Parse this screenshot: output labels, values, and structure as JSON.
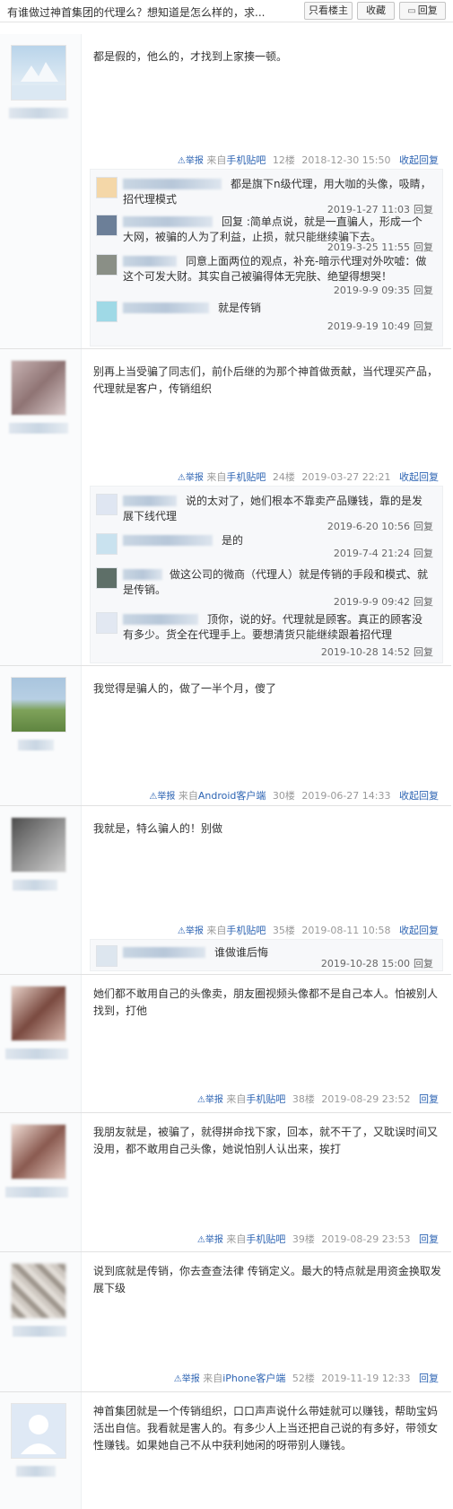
{
  "header": {
    "title": "有谁做过神首集团的代理么？想知道是怎么样的，求...",
    "only_op": "只看楼主",
    "favorite": "收藏",
    "reply": "回复"
  },
  "labels": {
    "report": "举报",
    "collapse_reply": "收起回复",
    "reply": "回复",
    "from": "来自"
  },
  "posts": [
    {
      "content": "都是假的，他么的，才找到上家揍一顿。",
      "source": "手机贴吧",
      "floor": "12楼",
      "time": "2018-12-30 15:50",
      "action": "收起回复",
      "replies": [
        {
          "text": "都是旗下n级代理，用大咖的头像，吸睛，招代理模式",
          "time": "2019-1-27 11:03"
        },
        {
          "text": "回复 :简单点说，就是一直骗人，形成一个大网，被骗的人为了利益，止损，就只能继续骗下去。",
          "time": "2019-3-25 11:55"
        },
        {
          "text": "同意上面两位的观点，补充-暗示代理对外吹嘘：做这个可发大财。其实自己被骗得体无完肤、绝望得想哭！",
          "time": "2019-9-9 09:35"
        },
        {
          "text": "就是传销",
          "time": "2019-9-19 10:49"
        }
      ]
    },
    {
      "content": "别再上当受骗了同志们，前仆后继的为那个神首做贡献，当代理买产品，代理就是客户，传销组织",
      "source": "手机贴吧",
      "floor": "24楼",
      "time": "2019-03-27 22:21",
      "action": "收起回复",
      "replies": [
        {
          "text": "说的太对了，她们根本不靠卖产品赚钱，靠的是发展下线代理",
          "time": "2019-6-20 10:56"
        },
        {
          "text": "是的",
          "time": "2019-7-4 21:24"
        },
        {
          "text": "做这公司的微商（代理人）就是传销的手段和模式、就是传销。",
          "time": "2019-9-9 09:42"
        },
        {
          "text": "顶你，说的好。代理就是顾客。真正的顾客没有多少。货全在代理手上。要想清货只能继续跟着招代理",
          "time": "2019-10-28 14:52"
        }
      ]
    },
    {
      "content": "我觉得是骗人的，做了一半个月，傻了",
      "source": "Android客户端",
      "floor": "30楼",
      "time": "2019-06-27 14:33",
      "action": "收起回复",
      "replies": []
    },
    {
      "content": "我就是，特么骗人的！别做",
      "source": "手机贴吧",
      "floor": "35楼",
      "time": "2019-08-11 10:58",
      "action": "收起回复",
      "replies": [
        {
          "text": "谁做谁后悔",
          "time": "2019-10-28 15:00"
        }
      ]
    },
    {
      "content": "她们都不敢用自己的头像卖，朋友圈视频头像都不是自己本人。怕被别人找到，打他",
      "source": "手机贴吧",
      "floor": "38楼",
      "time": "2019-08-29 23:52",
      "action": "回复",
      "replies": []
    },
    {
      "content": "我朋友就是，被骗了，就得拼命找下家，回本，就不干了，又耽误时间又没用，都不敢用自己头像，她说怕别人认出来，挨打",
      "source": "手机贴吧",
      "floor": "39楼",
      "time": "2019-08-29 23:53",
      "action": "回复",
      "replies": []
    },
    {
      "content": "说到底就是传销，你去查查法律 传销定义。最大的特点就是用资金换取发展下级",
      "source": "iPhone客户端",
      "floor": "52楼",
      "time": "2019-11-19 12:33",
      "action": "回复",
      "replies": []
    },
    {
      "content": "神首集团就是一个传销组织，口口声声说什么带娃就可以赚钱，帮助宝妈活出自信。我看就是害人的。有多少人上当还把自己说的有多好，带领女性赚钱。如果她自己不从中获利她闲的呀带别人赚钱。",
      "source": "",
      "floor": "",
      "time": "",
      "action": "",
      "replies": []
    }
  ],
  "colors": {
    "link": "#2d64b3",
    "meta": "#999999",
    "border": "#e1e1e1",
    "subbg": "#f7f8fa"
  }
}
